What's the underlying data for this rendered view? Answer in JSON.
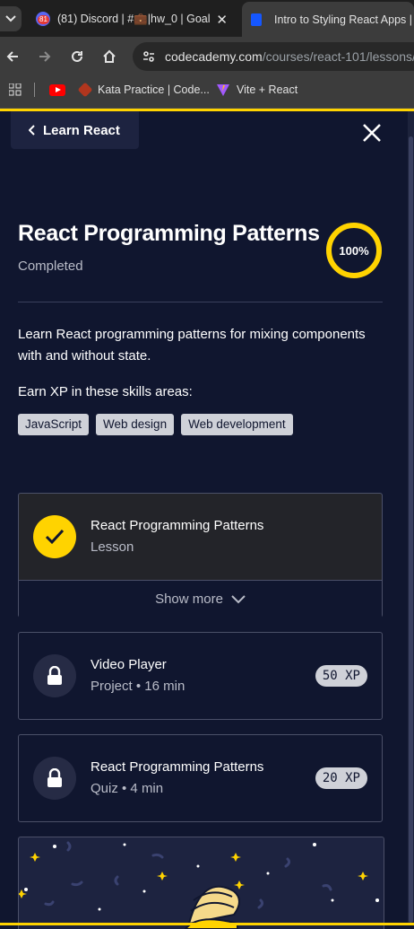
{
  "browser": {
    "tabs": [
      {
        "title": "(81) Discord | #💼|hw_0 | Goal",
        "badge": "81",
        "active": false
      },
      {
        "title": "Intro to Styling React Apps | Re",
        "active": true
      }
    ],
    "url_host": "codecademy.com",
    "url_path": "/courses/react-101/lessons/",
    "bookmarks": [
      {
        "label": "",
        "icon": "youtube-icon"
      },
      {
        "label": "Kata Practice | Code...",
        "icon": "codewars-icon"
      },
      {
        "label": "Vite + React",
        "icon": "vite-icon"
      }
    ]
  },
  "header": {
    "back_label": "Learn React"
  },
  "module": {
    "title": "React Programming Patterns",
    "status": "Completed",
    "progress_label": "100%",
    "progress_fraction": 1.0,
    "description": "Learn React programming patterns for mixing components with and without state.",
    "skills_label": "Earn XP in these skills areas:",
    "skills": [
      "JavaScript",
      "Web design",
      "Web development"
    ]
  },
  "items": [
    {
      "title": "React Programming Patterns",
      "subtitle": "Lesson",
      "state": "completed",
      "more_label": "Show more"
    },
    {
      "title": "Video Player",
      "subtitle": "Project • 16 min",
      "xp": "50 XP",
      "state": "locked"
    },
    {
      "title": "React Programming Patterns",
      "subtitle": "Quiz • 4 min",
      "xp": "20 XP",
      "state": "locked"
    }
  ],
  "colors": {
    "accent": "#ffd300",
    "background": "#10162f",
    "tag_bg": "#cfd1d8"
  }
}
